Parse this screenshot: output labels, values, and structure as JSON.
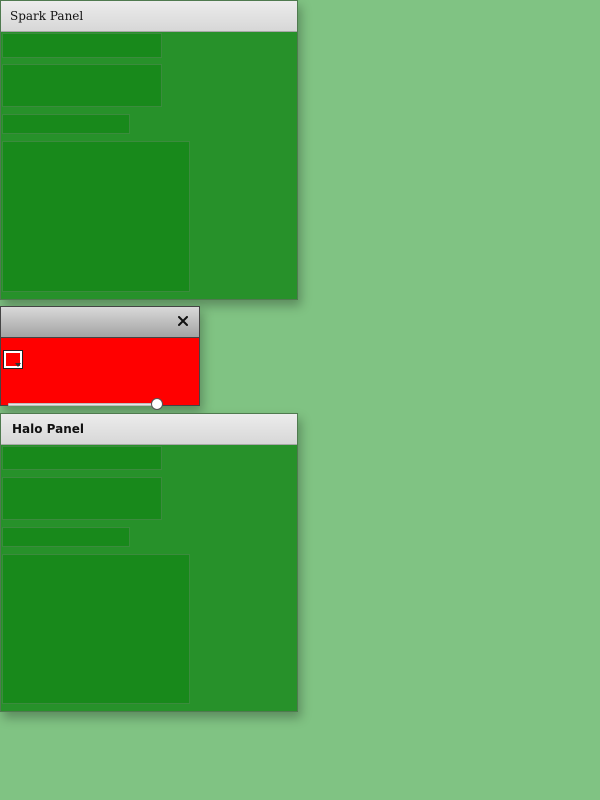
{
  "spark_panel": {
    "title": "Spark Panel"
  },
  "halo_panel": {
    "title": "Halo Panel"
  },
  "title_window": {
    "close_icon": "close-icon",
    "color_picker_value": "#ff0000",
    "slider_value_fraction": 1.0
  },
  "colors": {
    "page_bg": "#80c383",
    "panel_bg": "#27912a",
    "block_bg": "#18891b",
    "window_bg": "#ff0000"
  }
}
